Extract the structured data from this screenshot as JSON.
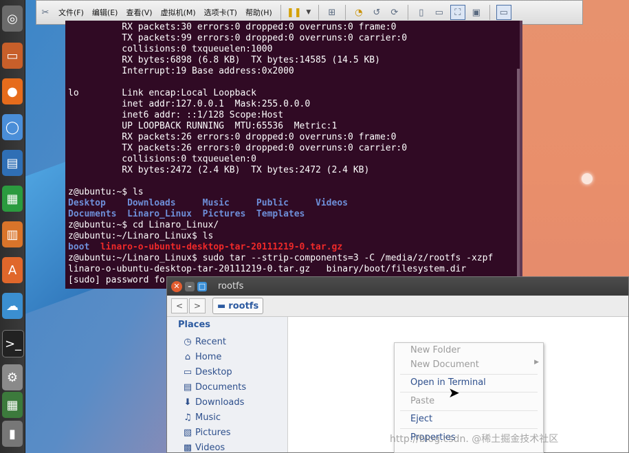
{
  "vm_toolbar": {
    "menus": [
      "文件(F)",
      "编辑(E)",
      "查看(V)",
      "虚拟机(M)",
      "选项卡(T)",
      "帮助(H)"
    ]
  },
  "terminal": {
    "lines": [
      [
        {
          "t": "          RX packets:30 errors:0 dropped:0 overruns:0 frame:0",
          "c": ""
        }
      ],
      [
        {
          "t": "          TX packets:99 errors:0 dropped:0 overruns:0 carrier:0",
          "c": ""
        }
      ],
      [
        {
          "t": "          collisions:0 txqueuelen:1000",
          "c": ""
        }
      ],
      [
        {
          "t": "          RX bytes:6898 (6.8 KB)  TX bytes:14585 (14.5 KB)",
          "c": ""
        }
      ],
      [
        {
          "t": "          Interrupt:19 Base address:0x2000",
          "c": ""
        }
      ],
      [
        {
          "t": "",
          "c": ""
        }
      ],
      [
        {
          "t": "lo        Link encap:Local Loopback",
          "c": ""
        }
      ],
      [
        {
          "t": "          inet addr:127.0.0.1  Mask:255.0.0.0",
          "c": ""
        }
      ],
      [
        {
          "t": "          inet6 addr: ::1/128 Scope:Host",
          "c": ""
        }
      ],
      [
        {
          "t": "          UP LOOPBACK RUNNING  MTU:65536  Metric:1",
          "c": ""
        }
      ],
      [
        {
          "t": "          RX packets:26 errors:0 dropped:0 overruns:0 frame:0",
          "c": ""
        }
      ],
      [
        {
          "t": "          TX packets:26 errors:0 dropped:0 overruns:0 carrier:0",
          "c": ""
        }
      ],
      [
        {
          "t": "          collisions:0 txqueuelen:0",
          "c": ""
        }
      ],
      [
        {
          "t": "          RX bytes:2472 (2.4 KB)  TX bytes:2472 (2.4 KB)",
          "c": ""
        }
      ],
      [
        {
          "t": "",
          "c": ""
        }
      ],
      [
        {
          "t": "z@ubuntu:~$ ls",
          "c": ""
        }
      ],
      [
        {
          "t": "Desktop    Downloads     Music     Public     Videos",
          "c": "blue"
        }
      ],
      [
        {
          "t": "Documents  Linaro_Linux  Pictures  Templates",
          "c": "blue"
        }
      ],
      [
        {
          "t": "z@ubuntu:~$ cd Linaro_Linux/",
          "c": ""
        }
      ],
      [
        {
          "t": "z@ubuntu:~/Linaro_Linux$ ls",
          "c": ""
        }
      ],
      [
        {
          "t": "boot",
          "c": "blue"
        },
        {
          "t": "  ",
          "c": ""
        },
        {
          "t": "linaro-o-ubuntu-desktop-tar-20111219-0.tar.gz",
          "c": "red"
        }
      ],
      [
        {
          "t": "z@ubuntu:~/Linaro_Linux$ sudo tar --strip-components=3 -C /media/z/rootfs -xzpf",
          "c": ""
        }
      ],
      [
        {
          "t": "linaro-o-ubuntu-desktop-tar-20111219-0.tar.gz   binary/boot/filesystem.dir",
          "c": ""
        }
      ],
      [
        {
          "t": "[sudo] password fo",
          "c": ""
        }
      ]
    ]
  },
  "file_manager": {
    "title": "rootfs",
    "path_label": "rootfs",
    "places_heading": "Places",
    "places": [
      {
        "label": "Recent",
        "icon": "clock-icon"
      },
      {
        "label": "Home",
        "icon": "home-icon"
      },
      {
        "label": "Desktop",
        "icon": "desktop-icon"
      },
      {
        "label": "Documents",
        "icon": "documents-icon"
      },
      {
        "label": "Downloads",
        "icon": "downloads-icon"
      },
      {
        "label": "Music",
        "icon": "music-icon"
      },
      {
        "label": "Pictures",
        "icon": "pictures-icon"
      },
      {
        "label": "Videos",
        "icon": "videos-icon"
      }
    ]
  },
  "context_menu": {
    "new_folder": "New Folder",
    "new_document": "New Document",
    "open_in_terminal": "Open in Terminal",
    "paste": "Paste",
    "eject": "Eject",
    "properties": "Properties"
  },
  "watermark": "http://blog.csdn.  @稀土掘金技术社区"
}
